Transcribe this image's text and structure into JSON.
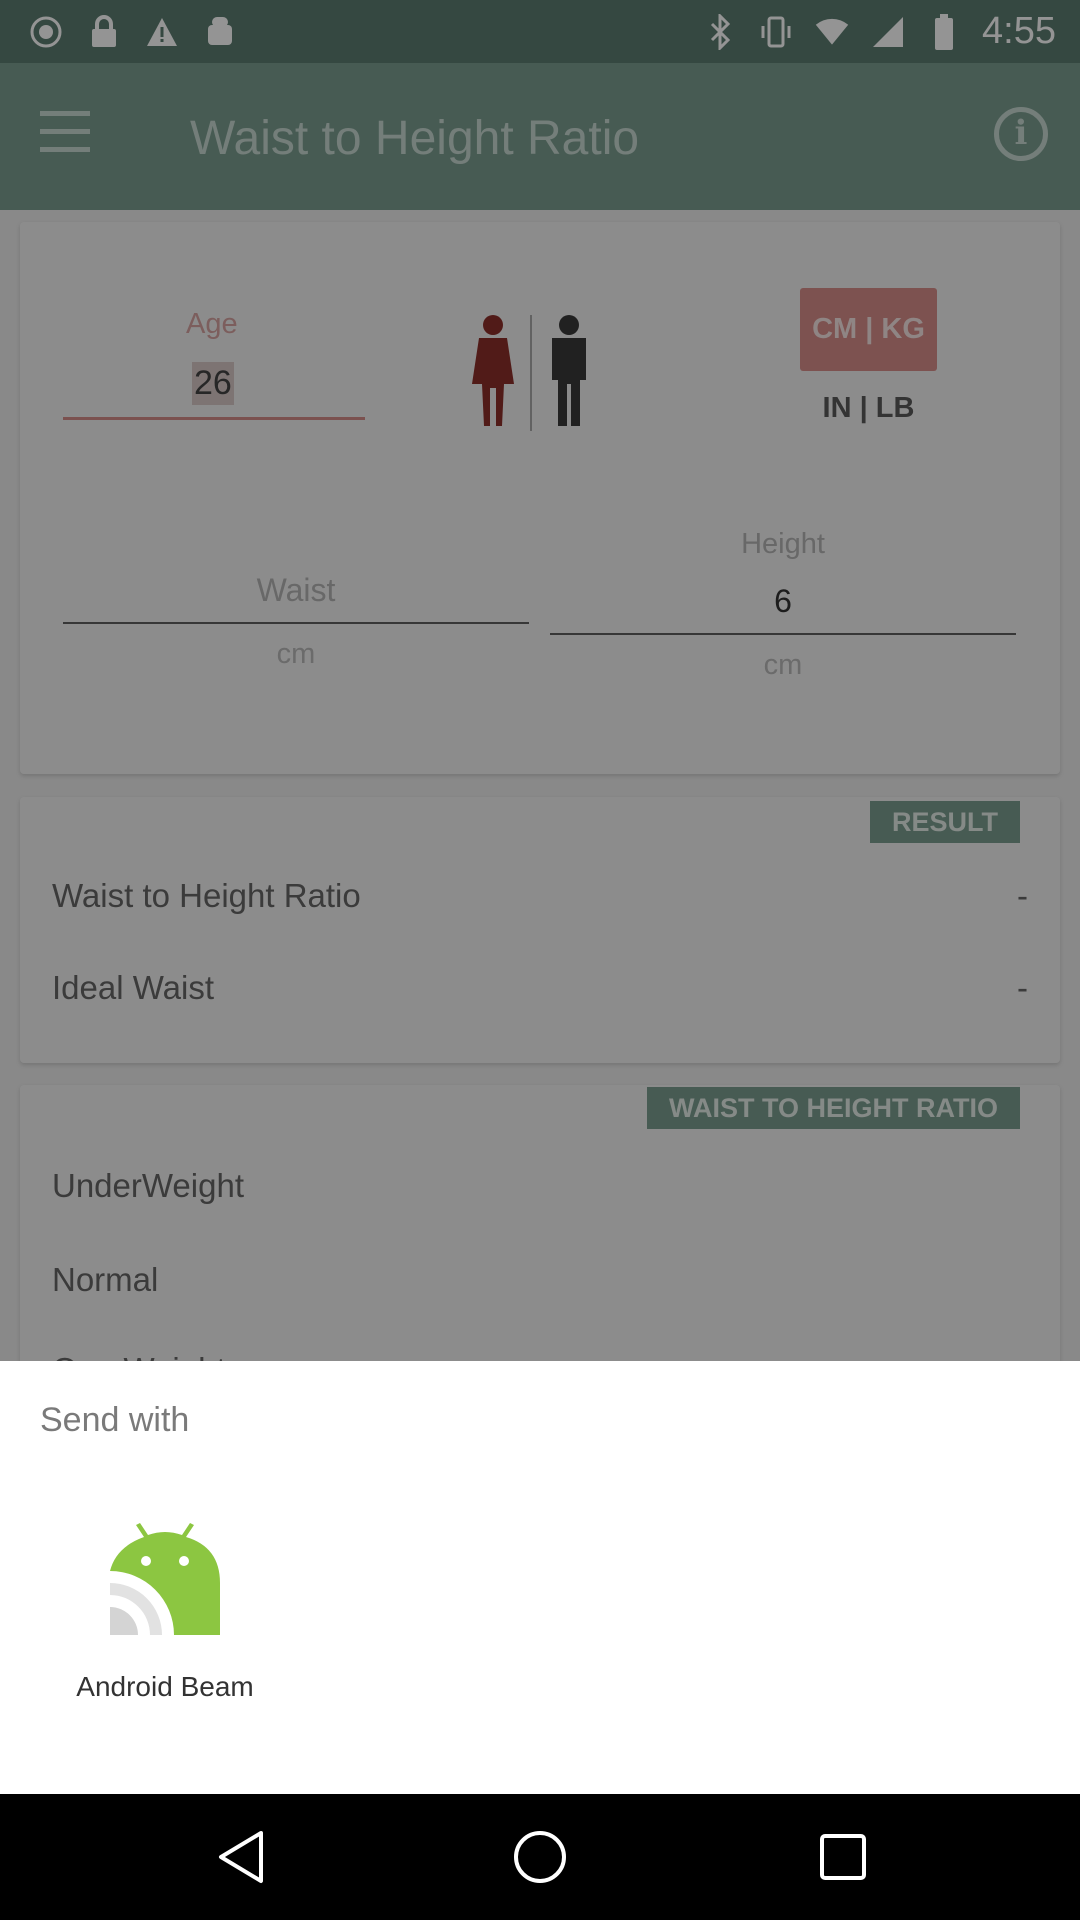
{
  "status_bar": {
    "time": "4:55",
    "left_icons": [
      "circle-status-icon",
      "lock-icon",
      "warning-icon",
      "android-icon"
    ],
    "right_icons": [
      "bluetooth-icon",
      "vibrate-icon",
      "wifi-icon",
      "signal-icon",
      "battery-icon"
    ]
  },
  "app_bar": {
    "title": "Waist to Height Ratio"
  },
  "inputs": {
    "age_label": "Age",
    "age_value": "26",
    "unit_metric": "CM | KG",
    "unit_imperial": "IN | LB",
    "waist_label": "",
    "waist_placeholder": "Waist",
    "waist_unit": "cm",
    "height_label": "Height",
    "height_value": "6",
    "height_unit": "cm"
  },
  "result": {
    "badge": "RESULT",
    "rows": [
      {
        "label": "Waist to Height Ratio",
        "value": "-"
      },
      {
        "label": "Ideal Waist",
        "value": "-"
      }
    ]
  },
  "ratio_table": {
    "badge": "WAIST TO HEIGHT RATIO",
    "rows": [
      {
        "label": "UnderWeight"
      },
      {
        "label": "Normal"
      },
      {
        "label": "OverWeight"
      }
    ]
  },
  "share_sheet": {
    "title": "Send with",
    "targets": [
      {
        "label": "Android Beam",
        "icon": "android-beam-icon"
      }
    ]
  },
  "colors": {
    "primary": "#1b5443",
    "accent": "#b01c14",
    "sheet_bg": "#ffffff"
  }
}
